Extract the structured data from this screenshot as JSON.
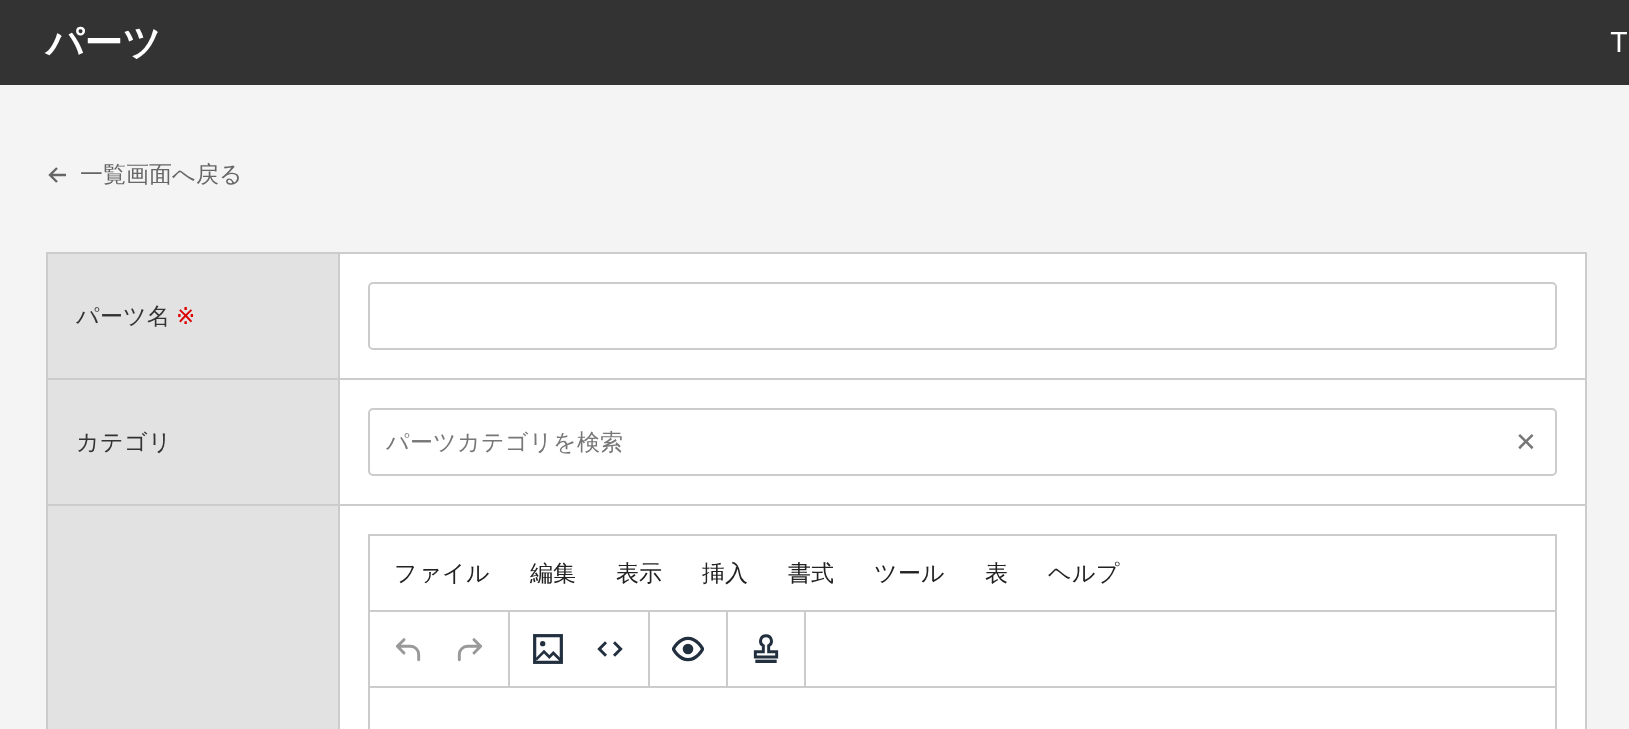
{
  "header": {
    "title": "パーツ",
    "right_text": "T"
  },
  "back_link": {
    "label": "一覧画面へ戻る"
  },
  "form": {
    "rows": [
      {
        "kind": "text",
        "label": "パーツ名",
        "required_mark": "※",
        "value": ""
      },
      {
        "kind": "search",
        "label": "カテゴリ",
        "placeholder": "パーツカテゴリを検索",
        "clear": "✕"
      },
      {
        "kind": "editor",
        "label": "",
        "menu": [
          "ファイル",
          "編集",
          "表示",
          "挿入",
          "書式",
          "ツール",
          "表",
          "ヘルプ"
        ],
        "toolbar": [
          [
            {
              "kind": "undo",
              "disabled": true
            },
            {
              "kind": "redo",
              "disabled": true
            }
          ],
          [
            {
              "kind": "image",
              "disabled": false
            },
            {
              "kind": "code",
              "disabled": false
            }
          ],
          [
            {
              "kind": "preview",
              "disabled": false
            }
          ],
          [
            {
              "kind": "stamp",
              "disabled": false
            }
          ]
        ]
      }
    ]
  }
}
